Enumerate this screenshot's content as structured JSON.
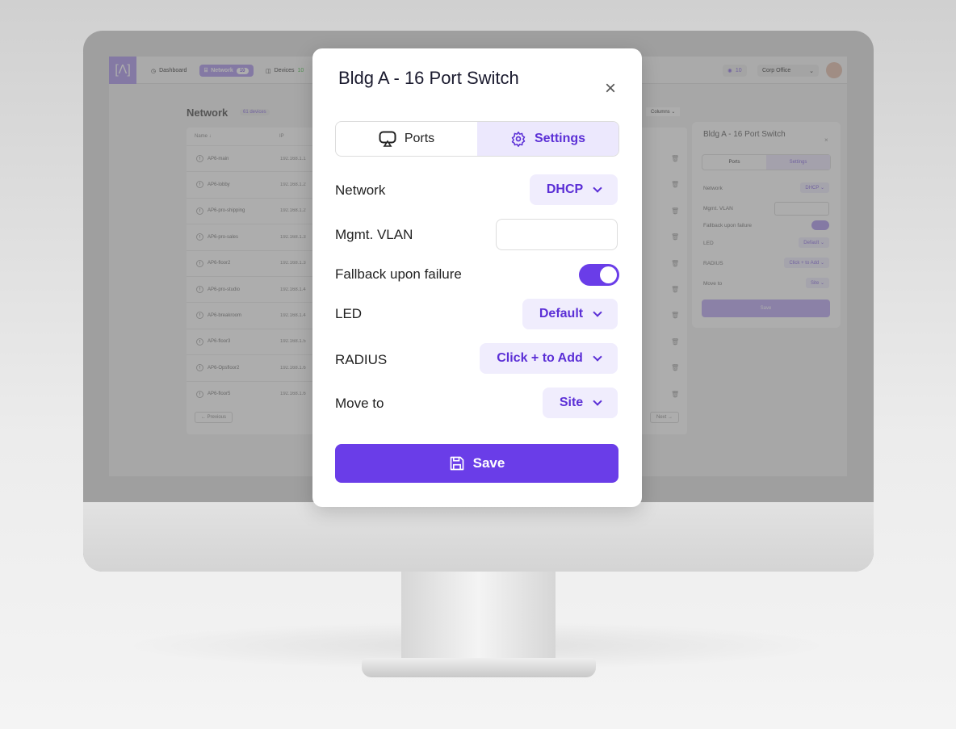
{
  "app": {
    "logo": "[Λ]",
    "nav": [
      {
        "label": "Dashboard",
        "icon": "gauge-icon"
      },
      {
        "label": "Network",
        "icon": "router-icon",
        "badge": "10"
      },
      {
        "label": "Devices",
        "icon": "devices-icon",
        "badge": "10"
      }
    ],
    "alerts_count": "10",
    "site_select": "Corp Office"
  },
  "page": {
    "title": "Network",
    "count_badge": "61 devices",
    "columns_button": "Columns",
    "headers": [
      "Name",
      "IP"
    ],
    "rows": [
      {
        "name": "AP6-main",
        "ip": "192.168.1.1"
      },
      {
        "name": "AP6-lobby",
        "ip": "192.168.1.2"
      },
      {
        "name": "AP6-pro-shipping",
        "ip": "192.168.1.2"
      },
      {
        "name": "AP6-pro-sales",
        "ip": "192.168.1.3"
      },
      {
        "name": "AP6-floor2",
        "ip": "192.168.1.3"
      },
      {
        "name": "AP6-pro-studio",
        "ip": "192.168.1.4"
      },
      {
        "name": "AP6-breakroom",
        "ip": "192.168.1.4"
      },
      {
        "name": "AP6-floor3",
        "ip": "192.168.1.5"
      },
      {
        "name": "AP6-Opsfloor2",
        "ip": "192.168.1.6"
      },
      {
        "name": "AP6-floor5",
        "ip": "192.168.1.6"
      }
    ],
    "previous": "Previous",
    "next": "Next"
  },
  "side_panel": {
    "title": "Bldg A - 16 Port Switch",
    "tabs": [
      "Ports",
      "Settings"
    ],
    "fields": [
      {
        "label": "Network",
        "value": "DHCP"
      },
      {
        "label": "Mgmt. VLAN",
        "value": ""
      },
      {
        "label": "Fallback upon failure",
        "value": ""
      },
      {
        "label": "LED",
        "value": "Default"
      },
      {
        "label": "RADIUS",
        "value": "Click + to Add"
      },
      {
        "label": "Move to",
        "value": "Site"
      }
    ],
    "save": "Save"
  },
  "modal": {
    "title": "Bldg A - 16 Port Switch",
    "tabs": {
      "ports": "Ports",
      "settings": "Settings",
      "active": "Settings"
    },
    "network_label": "Network",
    "network_value": "DHCP",
    "vlan_label": "Mgmt. VLAN",
    "vlan_value": "",
    "fallback_label": "Fallback upon failure",
    "fallback_on": true,
    "led_label": "LED",
    "led_value": "Default",
    "radius_label": "RADIUS",
    "radius_value": "Click + to Add",
    "move_label": "Move to",
    "move_value": "Site",
    "save": "Save"
  },
  "colors": {
    "accent": "#6a3de8",
    "accent_light": "#f0edfd"
  }
}
